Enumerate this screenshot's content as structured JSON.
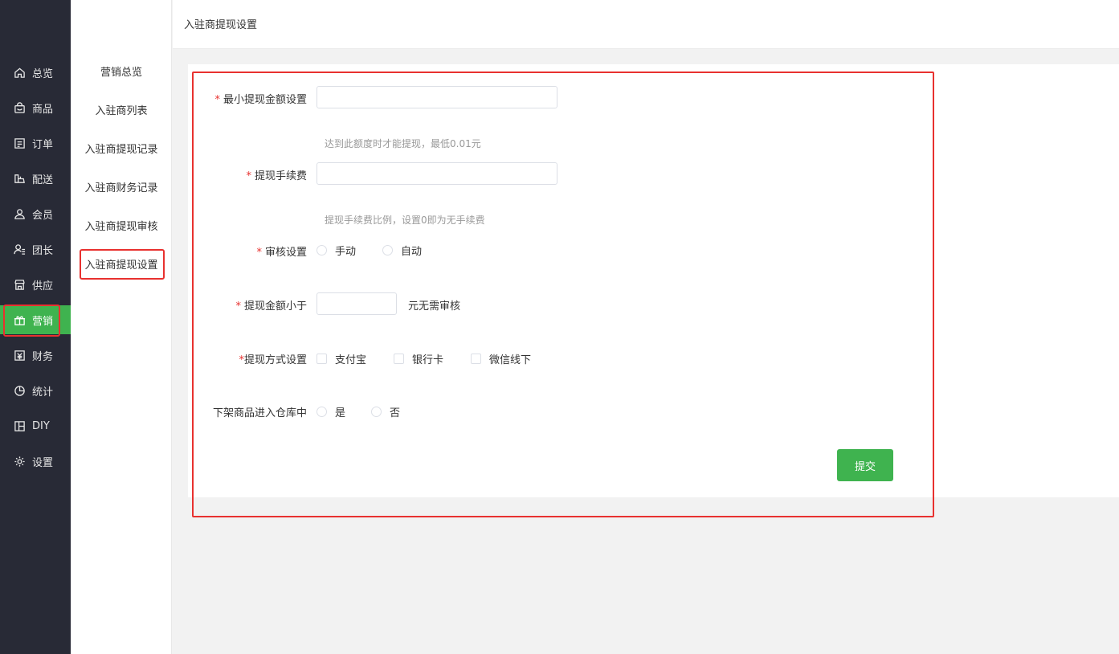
{
  "sidebar": {
    "items": [
      {
        "label": "总览",
        "icon": "home-icon"
      },
      {
        "label": "商品",
        "icon": "bag-icon"
      },
      {
        "label": "订单",
        "icon": "order-icon"
      },
      {
        "label": "配送",
        "icon": "delivery-icon"
      },
      {
        "label": "会员",
        "icon": "user-icon"
      },
      {
        "label": "团长",
        "icon": "leader-icon"
      },
      {
        "label": "供应",
        "icon": "store-icon"
      },
      {
        "label": "营销",
        "icon": "gift-icon"
      },
      {
        "label": "财务",
        "icon": "finance-icon"
      },
      {
        "label": "统计",
        "icon": "pie-icon"
      },
      {
        "label": "DIY",
        "icon": "layout-icon"
      },
      {
        "label": "设置",
        "icon": "gear-icon"
      }
    ],
    "active_index": 7,
    "active_color": "#3fb34f"
  },
  "submenu": {
    "items": [
      "营销总览",
      "入驻商列表",
      "入驻商提现记录",
      "入驻商财务记录",
      "入驻商提现审核",
      "入驻商提现设置"
    ],
    "active_index": 5
  },
  "header": {
    "breadcrumb": "入驻商提现设置"
  },
  "form": {
    "min_amount": {
      "label": "最小提现金额设置",
      "required_mark": "*",
      "value": "",
      "hint": "达到此额度时才能提现，最低0.01元"
    },
    "fee": {
      "label": "提现手续费",
      "required_mark": "*",
      "value": "",
      "hint": "提现手续费比例，设置0即为无手续费"
    },
    "review": {
      "label": "审核设置",
      "required_mark": "*",
      "options": [
        "手动",
        "自动"
      ],
      "selected": null
    },
    "amount_below": {
      "label": "提现金额小于",
      "required_mark": "*",
      "value": "",
      "suffix": "元无需审核"
    },
    "methods": {
      "label": "提现方式设置",
      "required_mark": "*",
      "options": [
        "支付宝",
        "银行卡",
        "微信线下"
      ],
      "checked": []
    },
    "offshelf": {
      "label": "下架商品进入仓库中",
      "options": [
        "是",
        "否"
      ],
      "selected": null
    },
    "submit_label": "提交"
  },
  "colors": {
    "sidebar_bg": "#282a36",
    "primary": "#3fb34f",
    "highlight": "#e8312f",
    "required": "#e8312f"
  }
}
